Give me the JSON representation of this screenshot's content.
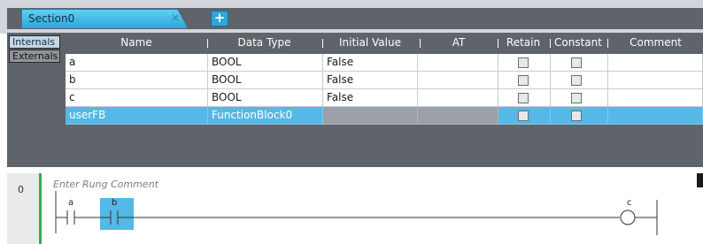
{
  "tabs": {
    "active_label": "Section0",
    "close_glyph": "×",
    "add_glyph": "+"
  },
  "side_tabs": {
    "internals": "Internals",
    "externals": "Externals"
  },
  "table": {
    "columns": [
      "Name",
      "Data Type",
      "Initial Value",
      "AT",
      "Retain",
      "Constant",
      "Comment"
    ],
    "rows": [
      {
        "name": "a",
        "data_type": "BOOL",
        "initial_value": "False",
        "at": "",
        "retain": false,
        "constant": false,
        "comment": "",
        "selected": false
      },
      {
        "name": "b",
        "data_type": "BOOL",
        "initial_value": "False",
        "at": "",
        "retain": false,
        "constant": false,
        "comment": "",
        "selected": false
      },
      {
        "name": "c",
        "data_type": "BOOL",
        "initial_value": "False",
        "at": "",
        "retain": false,
        "constant": false,
        "comment": "",
        "selected": true
      },
      {
        "name": "userFB",
        "data_type": "FunctionBlock0",
        "initial_value": "",
        "at": "",
        "retain": false,
        "constant": false,
        "comment": "",
        "selected": true
      }
    ]
  },
  "ladder": {
    "rung_number": "0",
    "rung_comment_placeholder": "Enter Rung Comment",
    "contacts": [
      "a",
      "b"
    ],
    "coil": "c"
  },
  "colors": {
    "accent": "#2ea6d8",
    "selection": "#55b8e6",
    "panel": "#5f636a",
    "rail": "#3aa94e"
  }
}
